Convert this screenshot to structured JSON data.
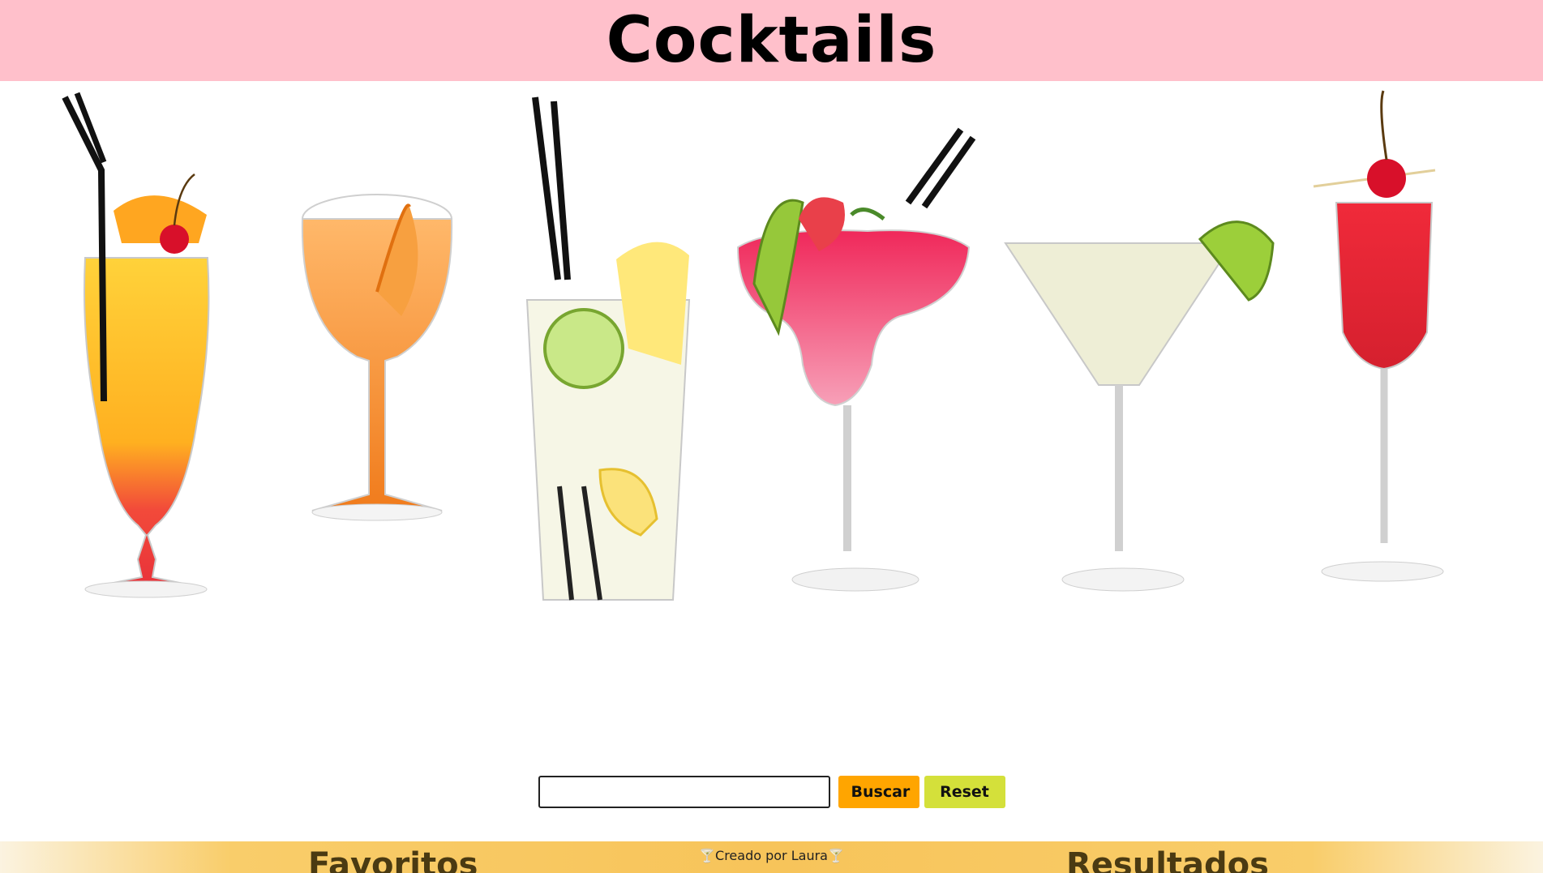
{
  "header": {
    "title": "Cocktails"
  },
  "search": {
    "value": "",
    "placeholder": "",
    "buscar_label": "Buscar",
    "reset_label": "Reset"
  },
  "footer": {
    "favorites_title": "Favoritos",
    "credit": "🍸Creado por Laura🍸",
    "results_title": "Resultados"
  },
  "colors": {
    "header_bg": "#ffc0cb",
    "buscar_bg": "#ffa500",
    "reset_bg": "#d4e03a",
    "footer_bg": "#f7c45a"
  },
  "hero": {
    "drinks": [
      "hurricane",
      "spritz",
      "mojito",
      "frozen-daiquiri",
      "martini",
      "champagne-cocktail"
    ]
  }
}
